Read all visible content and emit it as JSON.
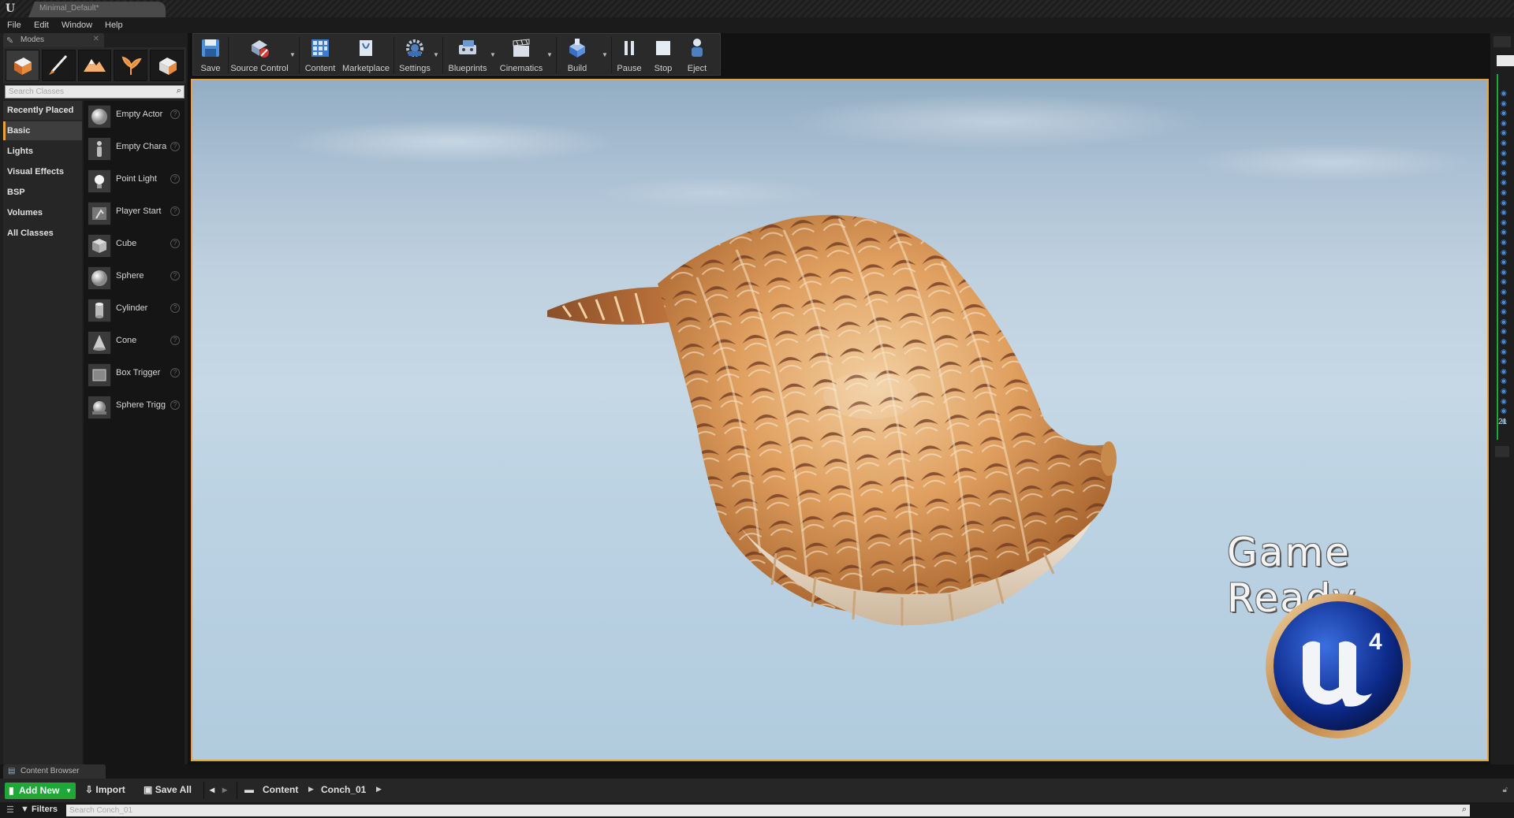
{
  "app": {
    "logo_text": "U",
    "document_tab": "Minimal_Default*"
  },
  "menu": [
    "File",
    "Edit",
    "Window",
    "Help"
  ],
  "modes_panel": {
    "tab_label": "Modes",
    "mode_icons": [
      "place-mode-icon",
      "paint-mode-icon",
      "landscape-mode-icon",
      "foliage-mode-icon",
      "geometry-mode-icon"
    ],
    "search_placeholder": "Search Classes",
    "categories": [
      "Recently Placed",
      "Basic",
      "Lights",
      "Visual Effects",
      "BSP",
      "Volumes",
      "All Classes"
    ],
    "selected_category": "Basic",
    "classes": [
      {
        "label": "Empty Actor",
        "icon": "sphere-icon"
      },
      {
        "label": "Empty Chara",
        "icon": "character-icon"
      },
      {
        "label": "Point Light",
        "icon": "lightbulb-icon"
      },
      {
        "label": "Player Start",
        "icon": "player-start-icon"
      },
      {
        "label": "Cube",
        "icon": "cube-icon"
      },
      {
        "label": "Sphere",
        "icon": "sphere-icon"
      },
      {
        "label": "Cylinder",
        "icon": "cylinder-icon"
      },
      {
        "label": "Cone",
        "icon": "cone-icon"
      },
      {
        "label": "Box Trigger",
        "icon": "box-trigger-icon"
      },
      {
        "label": "Sphere Trigg",
        "icon": "sphere-trigger-icon"
      }
    ]
  },
  "toolbar": {
    "buttons": [
      {
        "label": "Save",
        "icon": "save-icon"
      },
      {
        "label": "Source Control",
        "icon": "source-control-icon"
      },
      {
        "label": "Content",
        "icon": "content-icon"
      },
      {
        "label": "Marketplace",
        "icon": "marketplace-icon"
      },
      {
        "label": "Settings",
        "icon": "settings-icon"
      },
      {
        "label": "Blueprints",
        "icon": "blueprints-icon"
      },
      {
        "label": "Cinematics",
        "icon": "cinematics-icon"
      },
      {
        "label": "Build",
        "icon": "build-icon"
      },
      {
        "label": "Pause",
        "icon": "pause-icon"
      },
      {
        "label": "Stop",
        "icon": "stop-icon"
      },
      {
        "label": "Eject",
        "icon": "eject-icon"
      }
    ]
  },
  "viewport": {
    "overlay_text": "Game Ready",
    "logo": "UE4",
    "accent_color": "#e8a33b"
  },
  "right_panel": {
    "number": "21"
  },
  "content_browser": {
    "tab_label": "Content Browser",
    "add_new_label": "Add New",
    "import_label": "Import",
    "save_all_label": "Save All",
    "breadcrumb": [
      "Content",
      "Conch_01"
    ],
    "filters_label": "Filters",
    "search_placeholder": "Search Conch_01",
    "add_new_color": "#1fa838"
  }
}
